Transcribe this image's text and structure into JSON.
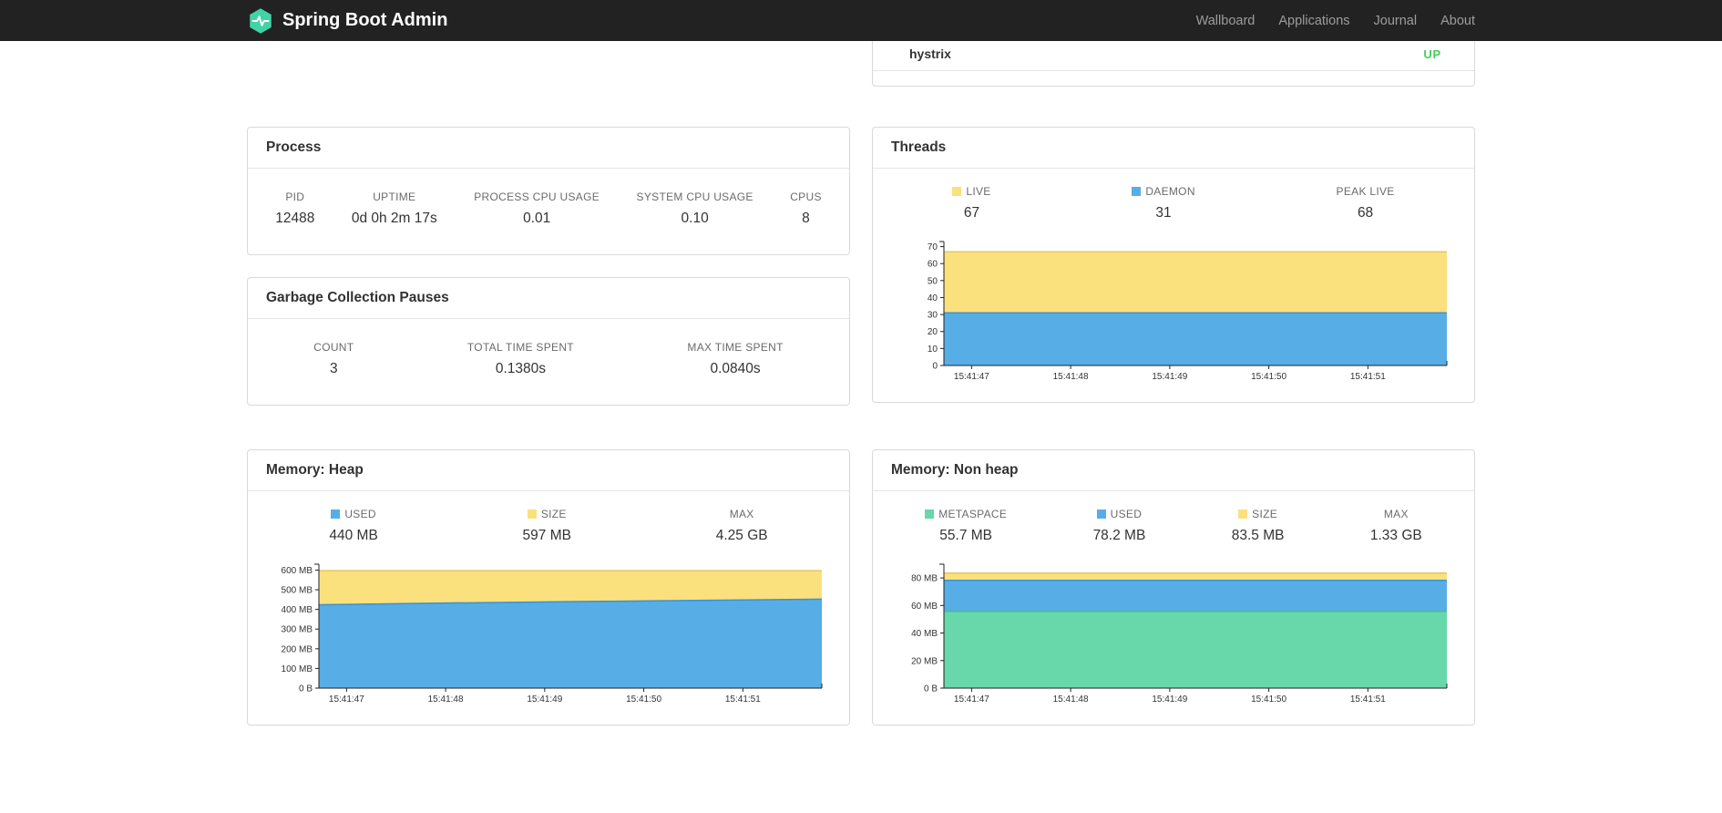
{
  "navbar": {
    "brand": "Spring Boot Admin",
    "links": [
      {
        "label": "Wallboard"
      },
      {
        "label": "Applications"
      },
      {
        "label": "Journal"
      },
      {
        "label": "About"
      }
    ]
  },
  "health": {
    "rows": [
      {
        "name": "hystrix",
        "status": "UP"
      }
    ]
  },
  "process": {
    "title": "Process",
    "stats": [
      {
        "label": "PID",
        "value": "12488"
      },
      {
        "label": "UPTIME",
        "value": "0d 0h 2m 17s"
      },
      {
        "label": "PROCESS CPU USAGE",
        "value": "0.01"
      },
      {
        "label": "SYSTEM CPU USAGE",
        "value": "0.10"
      },
      {
        "label": "CPUS",
        "value": "8"
      }
    ]
  },
  "gc": {
    "title": "Garbage Collection Pauses",
    "stats": [
      {
        "label": "COUNT",
        "value": "3"
      },
      {
        "label": "TOTAL TIME SPENT",
        "value": "0.1380s"
      },
      {
        "label": "MAX TIME SPENT",
        "value": "0.0840s"
      }
    ]
  },
  "threads": {
    "title": "Threads",
    "stats": [
      {
        "label": "LIVE",
        "value": "67"
      },
      {
        "label": "DAEMON",
        "value": "31"
      },
      {
        "label": "PEAK LIVE",
        "value": "68"
      }
    ]
  },
  "memory_heap": {
    "title": "Memory: Heap",
    "stats": [
      {
        "label": "USED",
        "value": "440 MB"
      },
      {
        "label": "SIZE",
        "value": "597 MB"
      },
      {
        "label": "MAX",
        "value": "4.25 GB"
      }
    ]
  },
  "memory_nonheap": {
    "title": "Memory: Non heap",
    "stats": [
      {
        "label": "METASPACE",
        "value": "55.7 MB"
      },
      {
        "label": "USED",
        "value": "78.2 MB"
      },
      {
        "label": "SIZE",
        "value": "83.5 MB"
      },
      {
        "label": "MAX",
        "value": "1.33 GB"
      }
    ]
  },
  "colors": {
    "navbar_bg": "#222222",
    "brand_green": "#42d3a5",
    "status_up_green": "#45d05c",
    "chart_blue": "#57ade6",
    "chart_yellow": "#fbe07e",
    "chart_green": "#68d7a9"
  },
  "chart_data": [
    {
      "id": "threads",
      "type": "area",
      "title": "Threads",
      "x_labels": [
        "15:41:47",
        "15:41:48",
        "15:41:49",
        "15:41:50",
        "15:41:51"
      ],
      "y_max": 73,
      "y_ticks": [
        {
          "value": 0,
          "label": "0"
        },
        {
          "value": 10,
          "label": "10"
        },
        {
          "value": 20,
          "label": "20"
        },
        {
          "value": 30,
          "label": "30"
        },
        {
          "value": 40,
          "label": "40"
        },
        {
          "value": 50,
          "label": "50"
        },
        {
          "value": 60,
          "label": "60"
        },
        {
          "value": 70,
          "label": "70"
        }
      ],
      "series": [
        {
          "name": "LIVE",
          "color": "#fbe07e",
          "line": "#e6c55e",
          "values": [
            67,
            67,
            67,
            67,
            67,
            67
          ]
        },
        {
          "name": "DAEMON",
          "color": "#57ade6",
          "line": "#3c92cc",
          "values": [
            31,
            31,
            31,
            31,
            31,
            31
          ]
        }
      ]
    },
    {
      "id": "memory-heap",
      "type": "area",
      "title": "Memory: Heap",
      "x_labels": [
        "15:41:47",
        "15:41:48",
        "15:41:49",
        "15:41:50",
        "15:41:51"
      ],
      "y_max": 630,
      "y_ticks": [
        {
          "value": 0,
          "label": "0 B"
        },
        {
          "value": 100,
          "label": "100 MB"
        },
        {
          "value": 200,
          "label": "200 MB"
        },
        {
          "value": 300,
          "label": "300 MB"
        },
        {
          "value": 400,
          "label": "400 MB"
        },
        {
          "value": 500,
          "label": "500 MB"
        },
        {
          "value": 600,
          "label": "600 MB"
        }
      ],
      "series": [
        {
          "name": "SIZE",
          "color": "#fbe07e",
          "line": "#e6c55e",
          "values": [
            597,
            597,
            597,
            597,
            597,
            597
          ]
        },
        {
          "name": "USED",
          "color": "#57ade6",
          "line": "#3c92cc",
          "values": [
            424,
            431,
            437,
            442,
            447,
            452
          ]
        }
      ]
    },
    {
      "id": "memory-nonheap",
      "type": "area",
      "title": "Memory: Non heap",
      "x_labels": [
        "15:41:47",
        "15:41:48",
        "15:41:49",
        "15:41:50",
        "15:41:51"
      ],
      "y_max": 90,
      "y_ticks": [
        {
          "value": 0,
          "label": "0 B"
        },
        {
          "value": 20,
          "label": "20 MB"
        },
        {
          "value": 40,
          "label": "40 MB"
        },
        {
          "value": 60,
          "label": "60 MB"
        },
        {
          "value": 80,
          "label": "80 MB"
        }
      ],
      "series": [
        {
          "name": "SIZE",
          "color": "#fbe07e",
          "line": "#e6c55e",
          "values": [
            83.5,
            83.5,
            83.5,
            83.5,
            83.5,
            83.5
          ]
        },
        {
          "name": "USED",
          "color": "#57ade6",
          "line": "#3c92cc",
          "values": [
            78.2,
            78.2,
            78.2,
            78.2,
            78.2,
            78.2
          ]
        },
        {
          "name": "METASPACE",
          "color": "#68d7a9",
          "line": "#49bd8c",
          "values": [
            55.7,
            55.7,
            55.7,
            55.7,
            55.7,
            55.7
          ]
        }
      ]
    }
  ]
}
